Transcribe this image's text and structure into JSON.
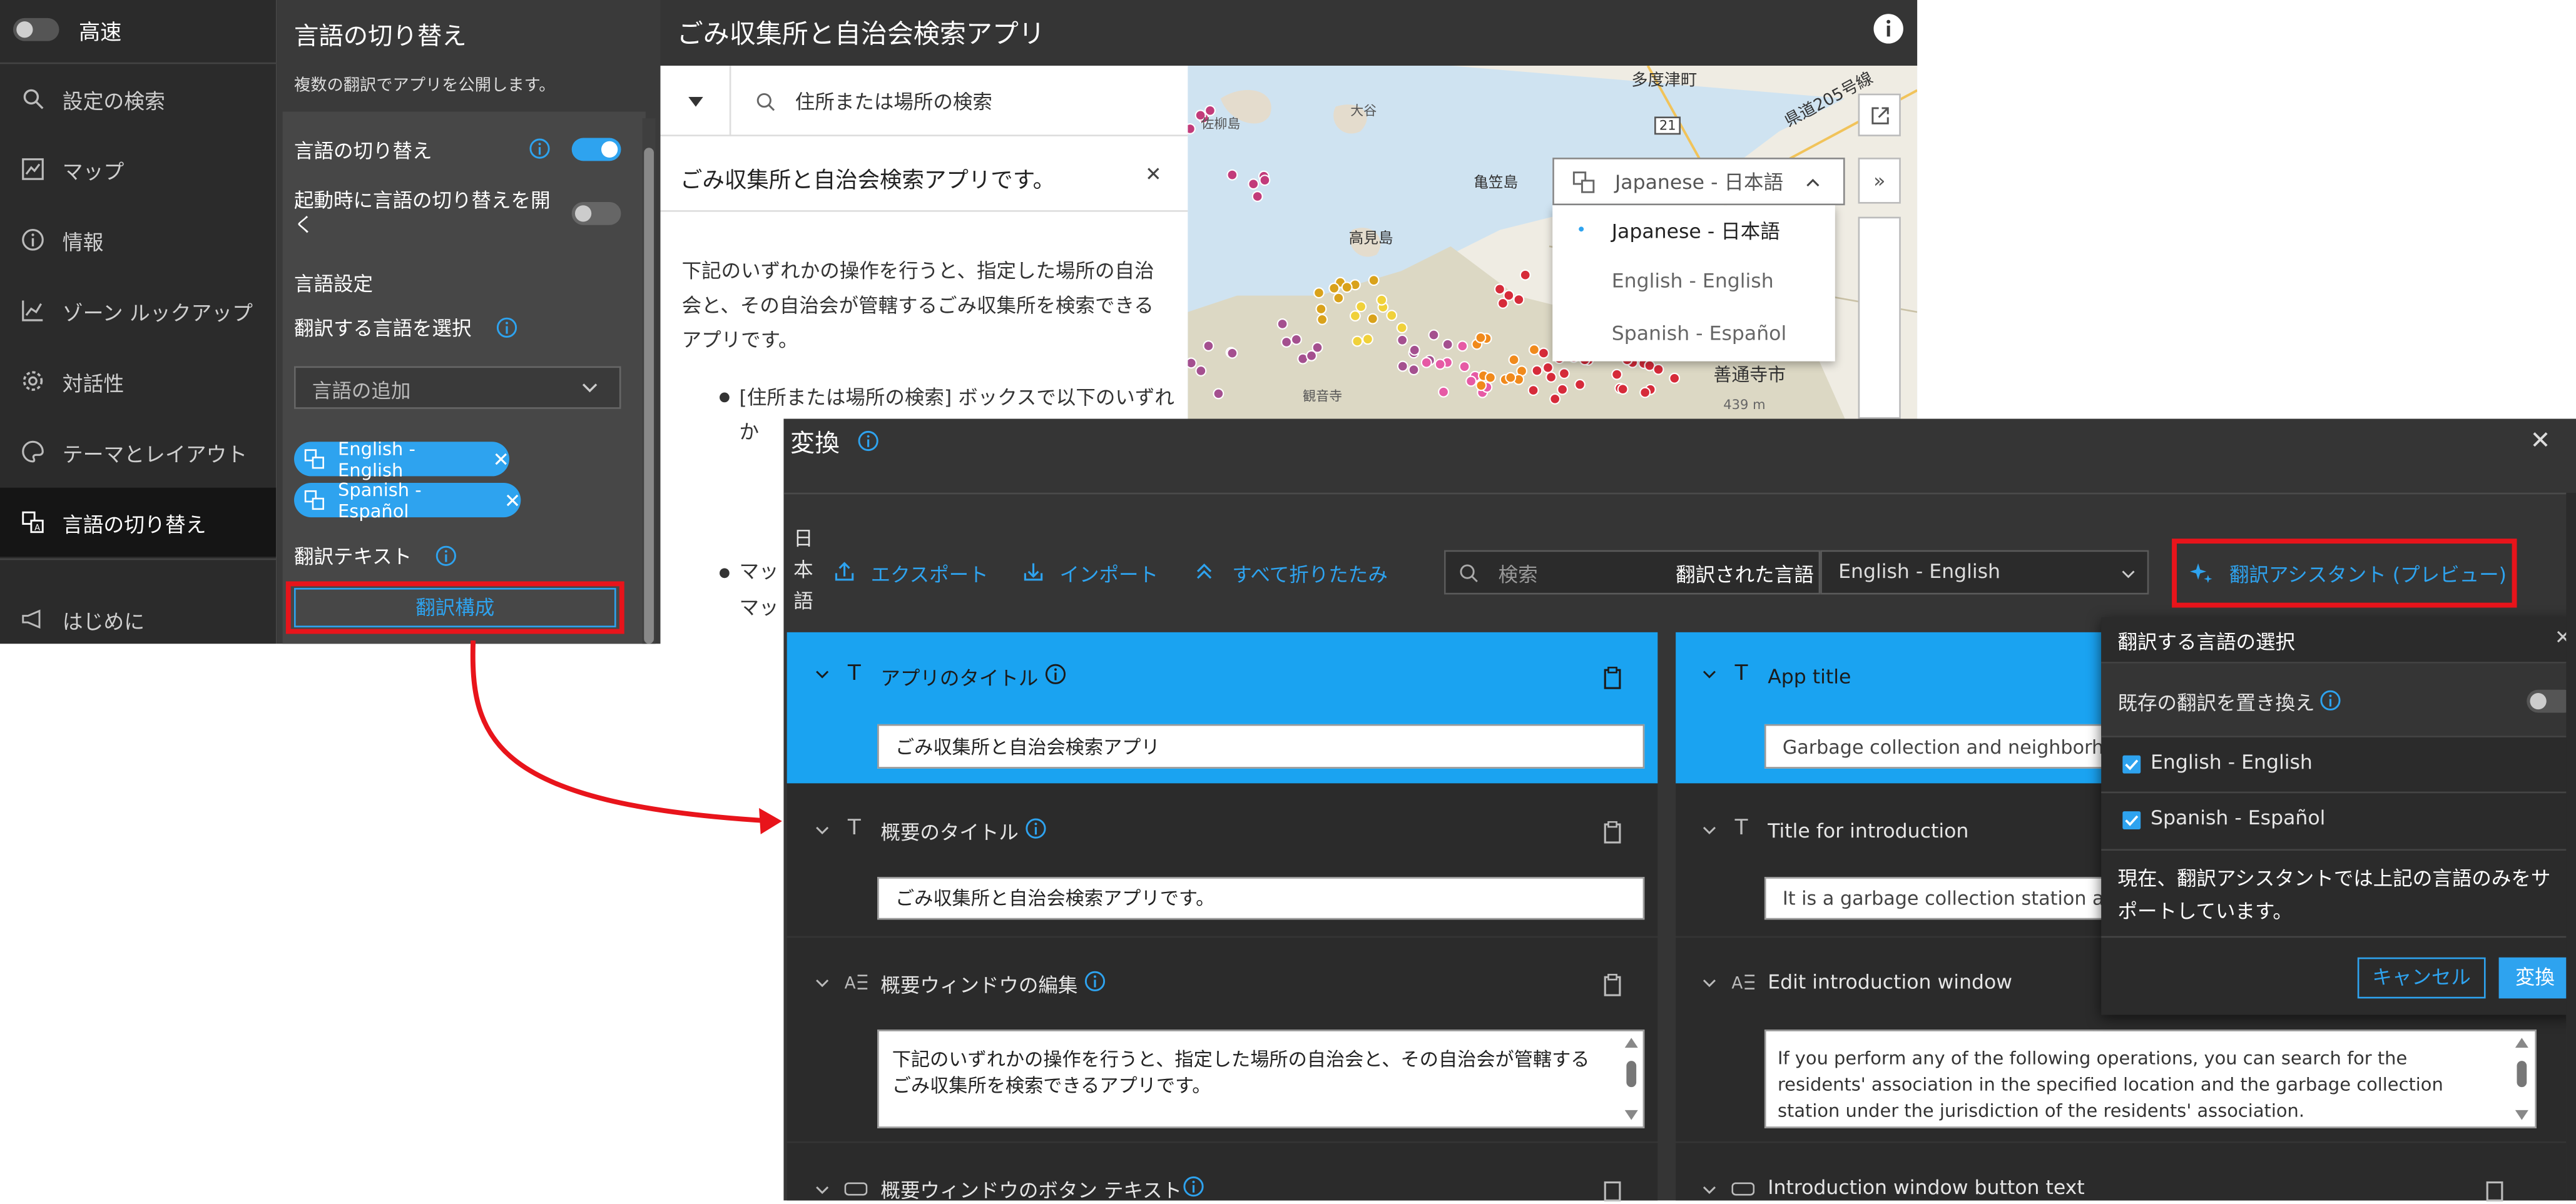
{
  "left_nav": {
    "toggle_label": "高速",
    "items": [
      {
        "label": "設定の検索",
        "icon": "search-icon"
      },
      {
        "label": "マップ",
        "icon": "map-icon"
      },
      {
        "label": "情報",
        "icon": "info-icon"
      },
      {
        "label": "ゾーン ルックアップ",
        "icon": "chart-icon"
      },
      {
        "label": "対話性",
        "icon": "gear-icon"
      },
      {
        "label": "テーマとレイアウト",
        "icon": "palette-icon"
      },
      {
        "label": "言語の切り替え",
        "icon": "translate-icon",
        "active": true
      },
      {
        "label": "はじめに",
        "icon": "megaphone-icon"
      }
    ]
  },
  "config": {
    "title": "言語の切り替え",
    "subtitle": "複数の翻訳でアプリを公開します。",
    "toggle1": {
      "label": "言語の切り替え",
      "on": true
    },
    "toggle2": {
      "label": "起動時に言語の切り替えを開く",
      "on": false
    },
    "settings_heading": "言語設定",
    "select_label": "翻訳する言語を選択",
    "add_language_placeholder": "言語の追加",
    "chips": [
      "English - English",
      "Spanish - Español"
    ],
    "translation_text_label": "翻訳テキスト",
    "configure_button": "翻訳構成"
  },
  "app": {
    "title": "ごみ収集所と自治会検索アプリ",
    "search_placeholder": "住所または場所の検索",
    "intro_title": "ごみ収集所と自治会検索アプリです。",
    "intro_para": "下記のいずれかの操作を行うと、指定した場所の自治会と、その自治会が管轄するごみ収集所を検索できるアプリです。",
    "bullet1": "[住所または場所の検索] ボックスで以下のいずれか",
    "bullet2": "マッ",
    "bullet2b": "マッ",
    "lang_dropdown": {
      "selected": "Japanese - 日本語",
      "options": [
        "Japanese - 日本語",
        "English - English",
        "Spanish - Español"
      ]
    },
    "map_labels": [
      "多度津町",
      "県道205号線",
      "21",
      "亀笠島",
      "高見島",
      "善通寺市",
      "439 m",
      "大谷",
      "佐柳島",
      "観音寺"
    ]
  },
  "modal": {
    "title": "変換",
    "source_language_label": "日本語",
    "export": "エクスポート",
    "import": "インポート",
    "collapse_all": "すべて折りたたみ",
    "search_placeholder": "検索",
    "translated_language_label": "翻訳された言語",
    "translated_language_value": "English - English",
    "assistant_button": "翻訳アシスタント (プレビュー)",
    "left_rows": [
      {
        "label": "アプリのタイトル",
        "value": "ごみ収集所と自治会検索アプリ"
      },
      {
        "label": "概要のタイトル",
        "value": "ごみ収集所と自治会検索アプリです。"
      },
      {
        "label": "概要ウィンドウの編集",
        "value": "下記のいずれかの操作を行うと、指定した場所の自治会と、その自治会が管轄するごみ収集所を検索できるアプリです。"
      },
      {
        "label": "概要ウィンドウのボタン テキスト"
      }
    ],
    "right_rows": [
      {
        "label": "App title",
        "value": "Garbage collection and neighborho"
      },
      {
        "label": "Title for introduction",
        "value": "It is a garbage collection station and"
      },
      {
        "label": "Edit introduction window",
        "value": "If you perform any of the following operations, you can search for the residents' association in the specified location and the garbage collection station under the jurisdiction of the residents' association."
      },
      {
        "label": "Introduction window button text"
      }
    ],
    "popover": {
      "title": "翻訳する言語の選択",
      "replace_label": "既存の翻訳を置き換え",
      "languages": [
        "English - English",
        "Spanish - Español"
      ],
      "note": "現在、翻訳アシスタントでは上記の言語のみをサポートしています。",
      "cancel": "キャンセル",
      "convert": "変換"
    }
  },
  "colors": {
    "accent": "#2ea3ef",
    "highlight": "#e8141b",
    "selected_row": "#1aa3f1"
  }
}
